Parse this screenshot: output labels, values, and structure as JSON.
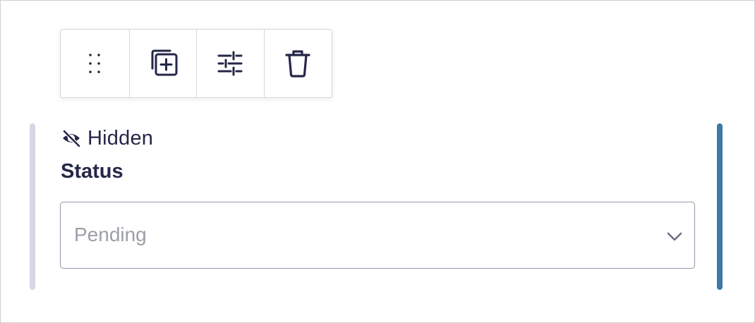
{
  "toolbar": {
    "buttons": [
      {
        "icon": "drag-handle-icon",
        "label": ""
      },
      {
        "icon": "duplicate-icon",
        "label": ""
      },
      {
        "icon": "settings-sliders-icon",
        "label": ""
      },
      {
        "icon": "trash-icon",
        "label": ""
      }
    ]
  },
  "field": {
    "visibility_icon": "eye-slash-icon",
    "visibility_text": "Hidden",
    "label": "Status",
    "select": {
      "value": "Pending",
      "icon": "chevron-down-icon"
    }
  },
  "colors": {
    "text": "#242748",
    "placeholder": "#9c9fa8",
    "left_bar": "#d5d7e4",
    "right_bar": "#3b7aa4",
    "border": "#d4d6de"
  }
}
